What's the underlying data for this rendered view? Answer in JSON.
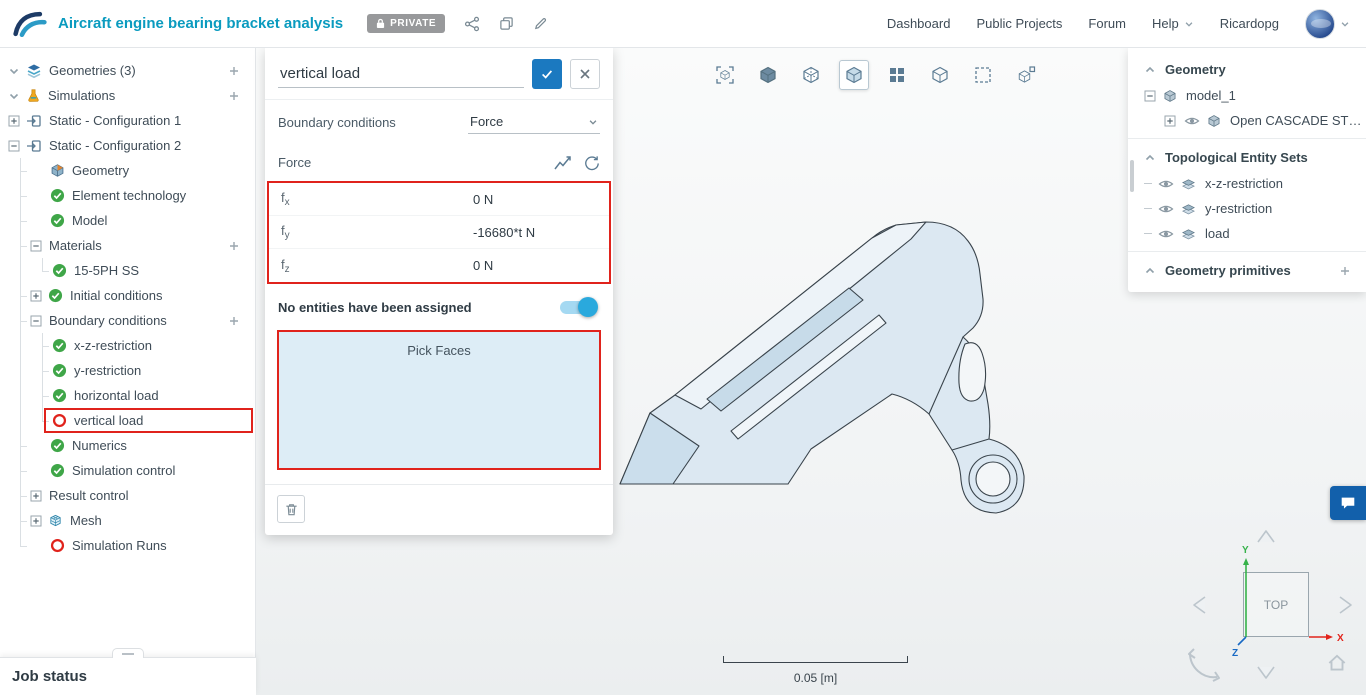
{
  "header": {
    "title": "Aircraft engine bearing bracket analysis",
    "private_badge": "PRIVATE",
    "nav_items": [
      "Dashboard",
      "Public Projects",
      "Forum"
    ],
    "help_label": "Help",
    "username": "Ricardopg"
  },
  "left_panel": {
    "tree": [
      {
        "label": "Geometries (3)",
        "icon": "layers",
        "chevron": "down",
        "add": true,
        "level": 0
      },
      {
        "label": "Simulations",
        "icon": "flask",
        "chevron": "down",
        "add": true,
        "level": 0
      },
      {
        "label": "Static - Configuration 1",
        "icon": "config",
        "expander": "plus",
        "level": 0
      },
      {
        "label": "Static - Configuration 2",
        "icon": "config",
        "expander": "minus",
        "level": 0
      },
      {
        "label": "Geometry",
        "icon": "geometry",
        "level": 1
      },
      {
        "label": "Element technology",
        "icon": "check",
        "level": 1
      },
      {
        "label": "Model",
        "icon": "check",
        "level": 1
      },
      {
        "label": "Materials",
        "expander": "minus",
        "add": true,
        "level": 1
      },
      {
        "label": "15-5PH SS",
        "icon": "check",
        "level": 2
      },
      {
        "label": "Initial conditions",
        "expander": "plus",
        "icon": "check",
        "level": 1
      },
      {
        "label": "Boundary conditions",
        "expander": "minus",
        "add": true,
        "level": 1
      },
      {
        "label": "x-z-restriction",
        "icon": "check",
        "level": 2
      },
      {
        "label": "y-restriction",
        "icon": "check",
        "level": 2
      },
      {
        "label": "horizontal load",
        "icon": "check",
        "level": 2
      },
      {
        "label": "vertical load",
        "icon": "circle-red",
        "level": 2,
        "selected": true
      },
      {
        "label": "Numerics",
        "icon": "check",
        "level": 1
      },
      {
        "label": "Simulation control",
        "icon": "check",
        "level": 1
      },
      {
        "label": "Result control",
        "expander": "plus",
        "level": 1
      },
      {
        "label": "Mesh",
        "expander": "plus",
        "icon": "mesh",
        "level": 1
      },
      {
        "label": "Simulation Runs",
        "icon": "circle-red",
        "level": 1
      }
    ],
    "job_status_label": "Job status"
  },
  "settings_panel": {
    "name_value": "vertical load",
    "type_label": "Boundary conditions",
    "type_value": "Force",
    "section_label": "Force",
    "force_rows": [
      {
        "label": "f",
        "sub": "x",
        "value": "0 N"
      },
      {
        "label": "f",
        "sub": "y",
        "value": "-16680*t N"
      },
      {
        "label": "f",
        "sub": "z",
        "value": "0 N"
      }
    ],
    "assignment_text": "No entities have been assigned",
    "pick_label": "Pick Faces"
  },
  "viewport": {
    "toolbar": [
      {
        "name": "fit-view",
        "selected": false
      },
      {
        "name": "shaded-view",
        "selected": false
      },
      {
        "name": "hidden-line-view",
        "selected": false
      },
      {
        "name": "shaded-edges-view",
        "selected": true
      },
      {
        "name": "split-view",
        "selected": false
      },
      {
        "name": "perspective-view",
        "selected": false
      },
      {
        "name": "box-select",
        "selected": false
      },
      {
        "name": "explode-view",
        "selected": false
      }
    ],
    "scale_label": "0.05 [m]",
    "cube_face_label": "TOP",
    "axes": {
      "x": "X",
      "y": "Y",
      "z": "Z"
    }
  },
  "right_panel": {
    "sections": [
      {
        "label": "Geometry",
        "add": false,
        "items": [
          {
            "label": "model_1",
            "icon": "cube",
            "expander": "minus",
            "level": 0
          },
          {
            "label": "Open CASCADE STE...",
            "icon": "cube",
            "eye": true,
            "expander": "plus",
            "level": 1
          }
        ]
      },
      {
        "label": "Topological Entity Sets",
        "add": false,
        "items": [
          {
            "label": "x-z-restriction",
            "icon": "faces",
            "eye": true,
            "dash": true,
            "level": 0
          },
          {
            "label": "y-restriction",
            "icon": "faces",
            "eye": true,
            "dash": true,
            "level": 0
          },
          {
            "label": "load",
            "icon": "faces",
            "eye": true,
            "dash": true,
            "level": 0
          }
        ]
      },
      {
        "label": "Geometry primitives",
        "add": true,
        "items": []
      }
    ]
  },
  "colors": {
    "accent_teal": "#0a9bbf",
    "accent_blue": "#1b79c0",
    "success_green": "#3fa648",
    "error_red": "#e0231c",
    "toggle_blue": "#2aa9dd"
  }
}
